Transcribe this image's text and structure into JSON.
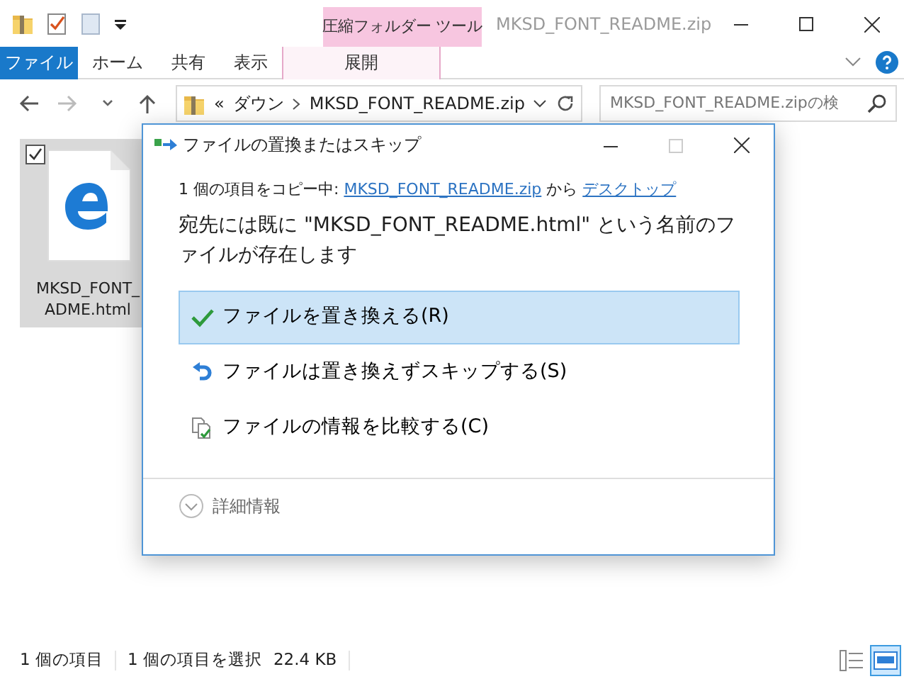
{
  "window": {
    "title": "MKSD_FONT_README.zip"
  },
  "ribbon": {
    "context_group": "圧縮フォルダー ツール",
    "tabs": [
      {
        "label": "ファイル",
        "kind": "file"
      },
      {
        "label": "ホーム",
        "kind": "plain"
      },
      {
        "label": "共有",
        "kind": "plain"
      },
      {
        "label": "表示",
        "kind": "plain"
      },
      {
        "label": "展開",
        "kind": "context"
      }
    ]
  },
  "address": {
    "prefix": "«",
    "segments": [
      "ダウン",
      "MKSD_FONT_README.zip"
    ]
  },
  "search": {
    "placeholder": "MKSD_FONT_README.zipの検"
  },
  "files": [
    {
      "name_lines": [
        "MKSD_FONT_",
        "ADME.html"
      ],
      "checked": true
    }
  ],
  "dialog": {
    "title": "ファイルの置換またはスキップ",
    "copy_line": {
      "prefix": "1 個の項目をコピー中: ",
      "source": "MKSD_FONT_README.zip",
      "middle": " から ",
      "destination": "デスクトップ"
    },
    "message": "宛先には既に \"MKSD_FONT_README.html\" という名前のファイルが存在します",
    "options": [
      {
        "kind": "replace",
        "label": "ファイルを置き換える(R)",
        "selected": true
      },
      {
        "kind": "skip",
        "label": "ファイルは置き換えずスキップする(S)",
        "selected": false
      },
      {
        "kind": "compare",
        "label": "ファイルの情報を比較する(C)",
        "selected": false
      }
    ],
    "details": "詳細情報"
  },
  "status_bar": {
    "item_count": "1 個の項目",
    "selection": "1 個の項目を選択",
    "size": "22.4 KB",
    "views": [
      {
        "kind": "details",
        "selected": false
      },
      {
        "kind": "large-icons",
        "selected": true
      }
    ]
  }
}
